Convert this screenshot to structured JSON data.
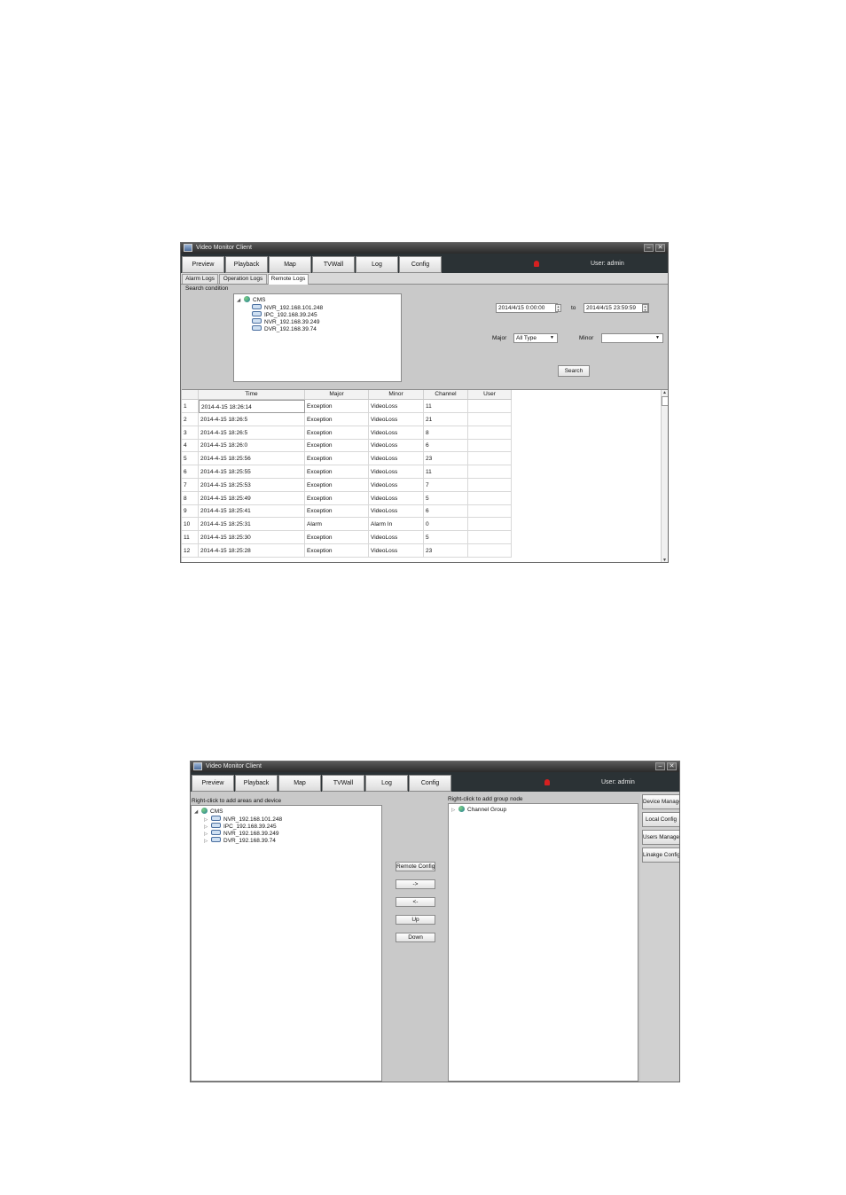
{
  "window1": {
    "title": "Video Monitor Client",
    "minimize": "–",
    "close": "✕",
    "nav": [
      "Preview",
      "Playback",
      "Map",
      "TVWall",
      "Log",
      "Config"
    ],
    "user": "User: admin",
    "log_tabs": [
      "Alarm Logs",
      "Operation Logs",
      "Remote Logs"
    ],
    "search_condition_label": "Search condition",
    "tree": {
      "root": "CMS",
      "devices": [
        "NVR_192.168.101.248",
        "IPC_192.168.39.245",
        "NVR_192.168.39.249",
        "DVR_192.168.39.74"
      ]
    },
    "date_from": "2014/4/15 0:00:00",
    "to_label": "to",
    "date_to": "2014/4/15 23:59:59",
    "major_label": "Major",
    "major_value": "All Type",
    "minor_label": "Minor",
    "minor_value": "",
    "search_button": "Search",
    "columns": [
      "Time",
      "Major",
      "Minor",
      "Channel",
      "User"
    ],
    "rows": [
      {
        "no": "1",
        "time": "2014-4-15 18:26:14",
        "major": "Exception",
        "minor": "VideoLoss",
        "channel": "11",
        "user": ""
      },
      {
        "no": "2",
        "time": "2014-4-15 18:26:5",
        "major": "Exception",
        "minor": "VideoLoss",
        "channel": "21",
        "user": ""
      },
      {
        "no": "3",
        "time": "2014-4-15 18:26:5",
        "major": "Exception",
        "minor": "VideoLoss",
        "channel": "8",
        "user": ""
      },
      {
        "no": "4",
        "time": "2014-4-15 18:26:0",
        "major": "Exception",
        "minor": "VideoLoss",
        "channel": "6",
        "user": ""
      },
      {
        "no": "5",
        "time": "2014-4-15 18:25:56",
        "major": "Exception",
        "minor": "VideoLoss",
        "channel": "23",
        "user": ""
      },
      {
        "no": "6",
        "time": "2014-4-15 18:25:55",
        "major": "Exception",
        "minor": "VideoLoss",
        "channel": "11",
        "user": ""
      },
      {
        "no": "7",
        "time": "2014-4-15 18:25:53",
        "major": "Exception",
        "minor": "VideoLoss",
        "channel": "7",
        "user": ""
      },
      {
        "no": "8",
        "time": "2014-4-15 18:25:49",
        "major": "Exception",
        "minor": "VideoLoss",
        "channel": "5",
        "user": ""
      },
      {
        "no": "9",
        "time": "2014-4-15 18:25:41",
        "major": "Exception",
        "minor": "VideoLoss",
        "channel": "6",
        "user": ""
      },
      {
        "no": "10",
        "time": "2014-4-15 18:25:31",
        "major": "Alarm",
        "minor": "Alarm In",
        "channel": "0",
        "user": ""
      },
      {
        "no": "11",
        "time": "2014-4-15 18:25:30",
        "major": "Exception",
        "minor": "VideoLoss",
        "channel": "5",
        "user": ""
      },
      {
        "no": "12",
        "time": "2014-4-15 18:25:28",
        "major": "Exception",
        "minor": "VideoLoss",
        "channel": "23",
        "user": ""
      }
    ]
  },
  "window2": {
    "title": "Video Monitor Client",
    "minimize": "–",
    "close": "✕",
    "nav": [
      "Preview",
      "Playback",
      "Map",
      "TVWall",
      "Log",
      "Config"
    ],
    "user": "User: admin",
    "left_hint": "Right-click to add areas and device",
    "tree": {
      "root": "CMS",
      "devices": [
        "NVR_192.168.101.248",
        "IPC_192.168.39.245",
        "NVR_192.168.39.249",
        "DVR_192.168.39.74"
      ]
    },
    "middle_buttons": [
      "Remote Config",
      "->",
      "<-",
      "Up",
      "Down"
    ],
    "right_hint": "Right-click to add group node",
    "group_node": "Channel Group",
    "side_buttons": [
      "Device Manage",
      "Local Config",
      "Users Manage",
      "Linakge Config"
    ]
  },
  "colors": {
    "navbar": "#2b3235",
    "titlebar": "#3a3a3a",
    "panel": "#c9c9c9",
    "alarm": "#d62020"
  }
}
